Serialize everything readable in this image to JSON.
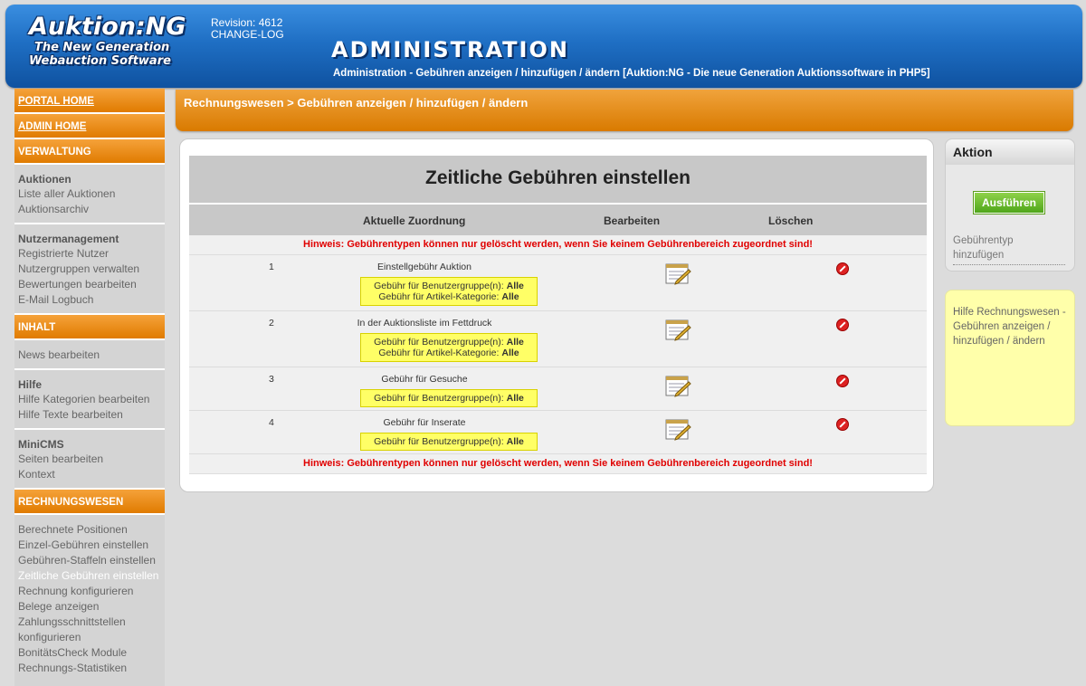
{
  "header": {
    "logo_lines": [
      "Auktion:NG",
      "The New Generation",
      "Webauction Software"
    ],
    "revision": "Revision: 4612",
    "changelog": "CHANGE-LOG",
    "title": "ADMINISTRATION",
    "subtitle": "Administration - Gebühren anzeigen / hinzufügen / ändern [Auktion:NG - Die neue Generation Auktionssoftware in PHP5]"
  },
  "sidebar": {
    "portal_home": "PORTAL HOME",
    "admin_home": "ADMIN HOME",
    "verwaltung": "VERWALTUNG",
    "auktionen": {
      "title": "Auktionen",
      "items": [
        "Liste aller Auktionen",
        "Auktionsarchiv"
      ]
    },
    "nutzer": {
      "title": "Nutzermanagement",
      "items": [
        "Registrierte Nutzer",
        "Nutzergruppen verwalten",
        "Bewertungen bearbeiten",
        "E-Mail Logbuch"
      ]
    },
    "inhalt": "INHALT",
    "news": {
      "items": [
        "News bearbeiten"
      ]
    },
    "hilfe": {
      "title": "Hilfe",
      "items": [
        "Hilfe Kategorien bearbeiten",
        "Hilfe Texte bearbeiten"
      ]
    },
    "minicms": {
      "title": "MiniCMS",
      "items": [
        "Seiten bearbeiten",
        "Kontext"
      ]
    },
    "rechnungswesen": "RECHNUNGSWESEN",
    "rw": {
      "items": [
        "Berechnete Positionen",
        "Einzel-Gebühren einstellen",
        "Gebühren-Staffeln einstellen",
        "Zeitliche Gebühren einstellen",
        "Rechnung konfigurieren",
        "Belege anzeigen",
        "Zahlungsschnittstellen",
        "konfigurieren",
        "BonitätsCheck Module",
        "Rechnungs-Statistiken"
      ],
      "active_index": 3
    }
  },
  "breadcrumb": "Rechnungswesen > Gebühren anzeigen / hinzufügen / ändern",
  "table": {
    "title": "Zeitliche Gebühren einstellen",
    "col_zuordnung": "Aktuelle Zuordnung",
    "col_bearbeiten": "Bearbeiten",
    "col_loeschen": "Löschen",
    "hint": "Hinweis: Gebührentypen können nur gelöscht werden, wenn Sie keinem Gebührenbereich zugeordnet sind!",
    "rows": [
      {
        "num": "1",
        "name": "Einstellgebühr Auktion",
        "group_label": "Gebühr für Benutzergruppe(n):",
        "group_value": "Alle",
        "cat_label": "Gebühr für Artikel-Kategorie:",
        "cat_value": "Alle"
      },
      {
        "num": "2",
        "name": "In der Auktionsliste im Fettdruck",
        "group_label": "Gebühr für Benutzergruppe(n):",
        "group_value": "Alle",
        "cat_label": "Gebühr für Artikel-Kategorie:",
        "cat_value": "Alle"
      },
      {
        "num": "3",
        "name": "Gebühr für Gesuche",
        "group_label": "Gebühr für Benutzergruppe(n):",
        "group_value": "Alle"
      },
      {
        "num": "4",
        "name": "Gebühr für Inserate",
        "group_label": "Gebühr für Benutzergruppe(n):",
        "group_value": "Alle"
      }
    ]
  },
  "aktion": {
    "title": "Aktion",
    "button": "Ausführen",
    "link": "Gebührentyp hinzufügen"
  },
  "help": "Hilfe Rechnungswesen - Gebühren anzeigen / hinzufügen / ändern",
  "colors": {
    "orange": "#e07b00",
    "header_blue": "#1f6fc4",
    "hint_red": "#e00000",
    "yellow_box": "#ffff66"
  }
}
